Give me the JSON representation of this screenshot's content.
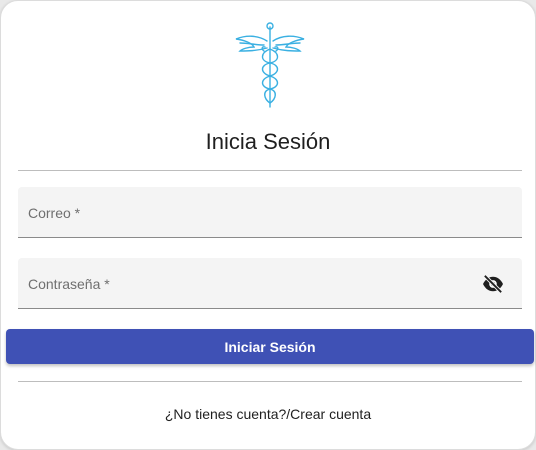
{
  "login": {
    "logo_icon": "caduceus-icon",
    "logo_color": "#3ab0e2",
    "title": "Inicia Sesión",
    "email_label": "Correo *",
    "password_label": "Contraseña *",
    "visibility_icon": "eye-off-icon",
    "submit_label": "Iniciar Sesión",
    "accent_color": "#3f51b5",
    "no_account_text": "¿No tienes cuenta?",
    "separator": "/",
    "create_account_link": "Crear cuenta"
  }
}
